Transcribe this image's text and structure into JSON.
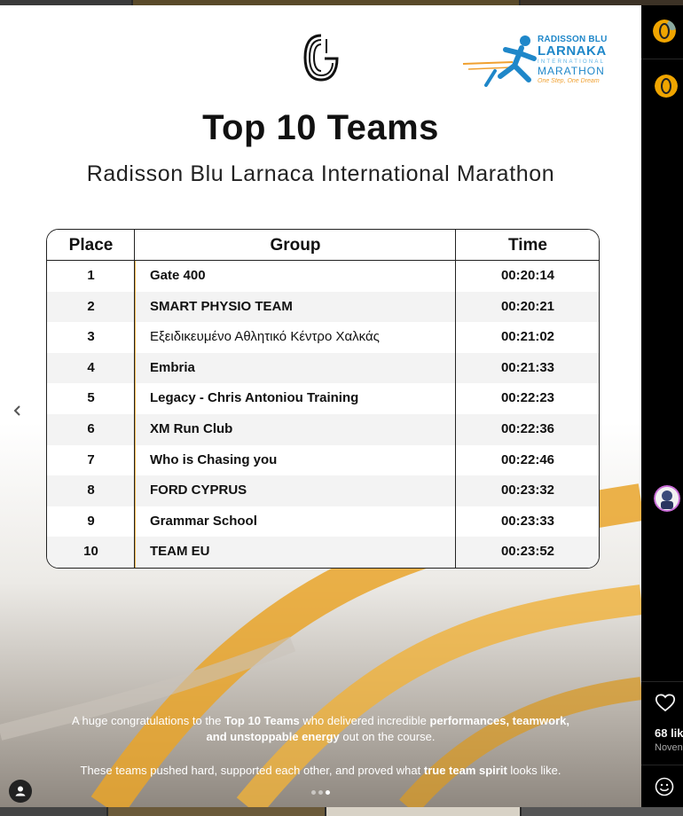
{
  "post": {
    "title": "Top 10 Teams",
    "subtitle": "Radisson Blu Larnaca International Marathon",
    "marathon_logo": {
      "line1": "RADISSON BLU",
      "line2": "LARNAKA",
      "line3": "INTERNATIONAL",
      "line4": "MARATHON",
      "tagline": "One Step, One Dream"
    },
    "table": {
      "headers": {
        "place": "Place",
        "group": "Group",
        "time": "Time"
      },
      "rows": [
        {
          "place": "1",
          "group": "Gate 400",
          "time": "00:20:14"
        },
        {
          "place": "2",
          "group": "SMART PHYSIO TEAM",
          "time": "00:20:21"
        },
        {
          "place": "3",
          "group": "Εξειδικευμένο Αθλητικό Κέντρο Χαλκάς",
          "time": "00:21:02"
        },
        {
          "place": "4",
          "group": "Embria",
          "time": "00:21:33"
        },
        {
          "place": "5",
          "group": "Legacy - Chris Antoniou Training",
          "time": "00:22:23"
        },
        {
          "place": "6",
          "group": "XM Run Club",
          "time": "00:22:36"
        },
        {
          "place": "7",
          "group": "Who is Chasing you",
          "time": "00:22:46"
        },
        {
          "place": "8",
          "group": "FORD CYPRUS",
          "time": "00:23:32"
        },
        {
          "place": "9",
          "group": "Grammar School",
          "time": "00:23:33"
        },
        {
          "place": "10",
          "group": "TEAM EU",
          "time": "00:23:52"
        }
      ]
    },
    "caption": {
      "p1_a": "A huge congratulations to the ",
      "p1_b": "Top 10 Teams",
      "p1_c": " who delivered incredible ",
      "p1_d": "performances, teamwork,",
      "p1_e": "and unstoppable energy",
      "p1_f": " out on the course.",
      "p2_a": "These teams pushed hard, supported each other, and proved what ",
      "p2_b": "true team spirit",
      "p2_c": " looks like."
    },
    "carousel": {
      "count": 3,
      "active_index": 3
    }
  },
  "sidebar": {
    "likes": "68 lik",
    "date": "Noven"
  },
  "icons": {
    "prev": "chevron-left-icon",
    "user_tag": "user-icon",
    "like": "heart-icon",
    "emoji": "smiley-icon",
    "brand": "brand-logo-icon"
  },
  "colors": {
    "gold": "#f0a500",
    "marathon_blue": "#1f87c9",
    "sidebar_bg": "#000000"
  }
}
